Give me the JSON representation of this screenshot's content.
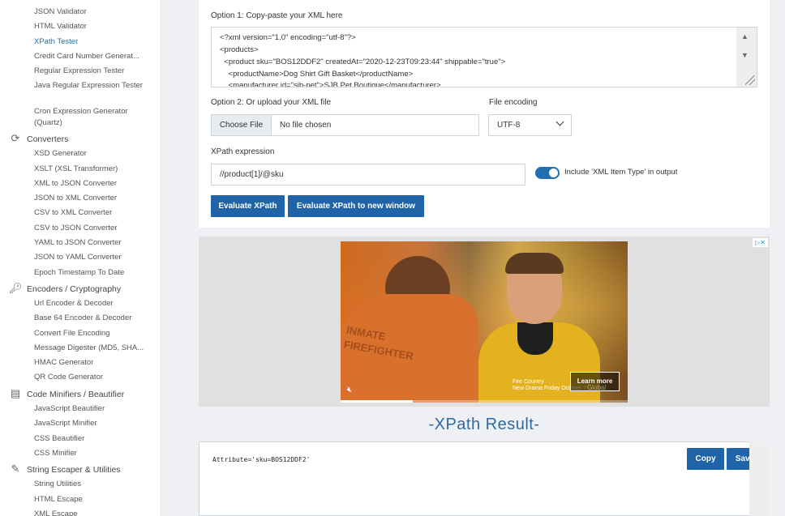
{
  "sidebar": {
    "links_top": [
      {
        "label": "JSON Validator"
      },
      {
        "label": "HTML Validator"
      },
      {
        "label": "XPath Tester",
        "active": true
      },
      {
        "label": "Credit Card Number Generat..."
      },
      {
        "label": "Regular Expression Tester"
      },
      {
        "label": "Java Regular Expression Tester"
      },
      {
        "label": "Cron Expression Generator (Quartz)"
      }
    ],
    "categories": [
      {
        "label": "Converters",
        "icon": "refresh-icon"
      },
      {
        "label": "Encoders / Cryptography",
        "icon": "key-icon"
      },
      {
        "label": "Code Minifiers / Beautifier",
        "icon": "file-icon"
      },
      {
        "label": "String Escaper & Utilities",
        "icon": "magic-wand-icon"
      }
    ],
    "converters": [
      "XSD Generator",
      "XSLT (XSL Transformer)",
      "XML to JSON Converter",
      "JSON to XML Converter",
      "CSV to XML Converter",
      "CSV to JSON Converter",
      "YAML to JSON Converter",
      "JSON to YAML Converter",
      "Epoch Timestamp To Date"
    ],
    "encoders": [
      "Url Encoder & Decoder",
      "Base 64 Encoder & Decoder",
      "Convert File Encoding",
      "Message Digester (MD5, SHA...",
      "HMAC Generator",
      "QR Code Generator"
    ],
    "minifiers": [
      "JavaScript Beautifier",
      "JavaScript Minifier",
      "CSS Beautifier",
      "CSS Minifier"
    ],
    "escapers": [
      "String Utilities",
      "HTML Escape",
      "XML Escape"
    ]
  },
  "form": {
    "option1_label": "Option 1: Copy-paste your XML here",
    "xml_lines": [
      "<?xml version=\"1.0\" encoding=\"utf-8\"?>",
      "<products>",
      "  <product sku=\"BOS12DDF2\" createdAt=\"2020-12-23T09:23:44\" shippable=\"true\">",
      "    <productName>Dog Shirt Gift Basket</productName>",
      "    <manufacturer id=\"sib-pet\">SJB Pet Boutique</manufacturer>"
    ],
    "option2_label": "Option 2: Or upload your XML file",
    "choose_file_label": "Choose File",
    "no_file_text": "No file chosen",
    "encoding_label": "File encoding",
    "encoding_value": "UTF-8",
    "xpath_label": "XPath expression",
    "xpath_value": "//product[1]/@sku",
    "toggle_label": "Include 'XML Item Type' in output",
    "toggle_on": true,
    "evaluate_label": "Evaluate XPath",
    "evaluate_window_label": "Evaluate XPath to new window"
  },
  "ad": {
    "shirt_text": "INMATE\nFIREFIGHTER",
    "brand_line1": "Fire Country",
    "brand_line2": "New Drama Friday October 7",
    "learn_more": "Learn more",
    "global_text": "Global",
    "progress": 0.25
  },
  "result": {
    "title": "-XPath Result-",
    "text": "Attribute='sku=BOS12DDF2'",
    "copy_label": "Copy",
    "save_label": "Save"
  }
}
